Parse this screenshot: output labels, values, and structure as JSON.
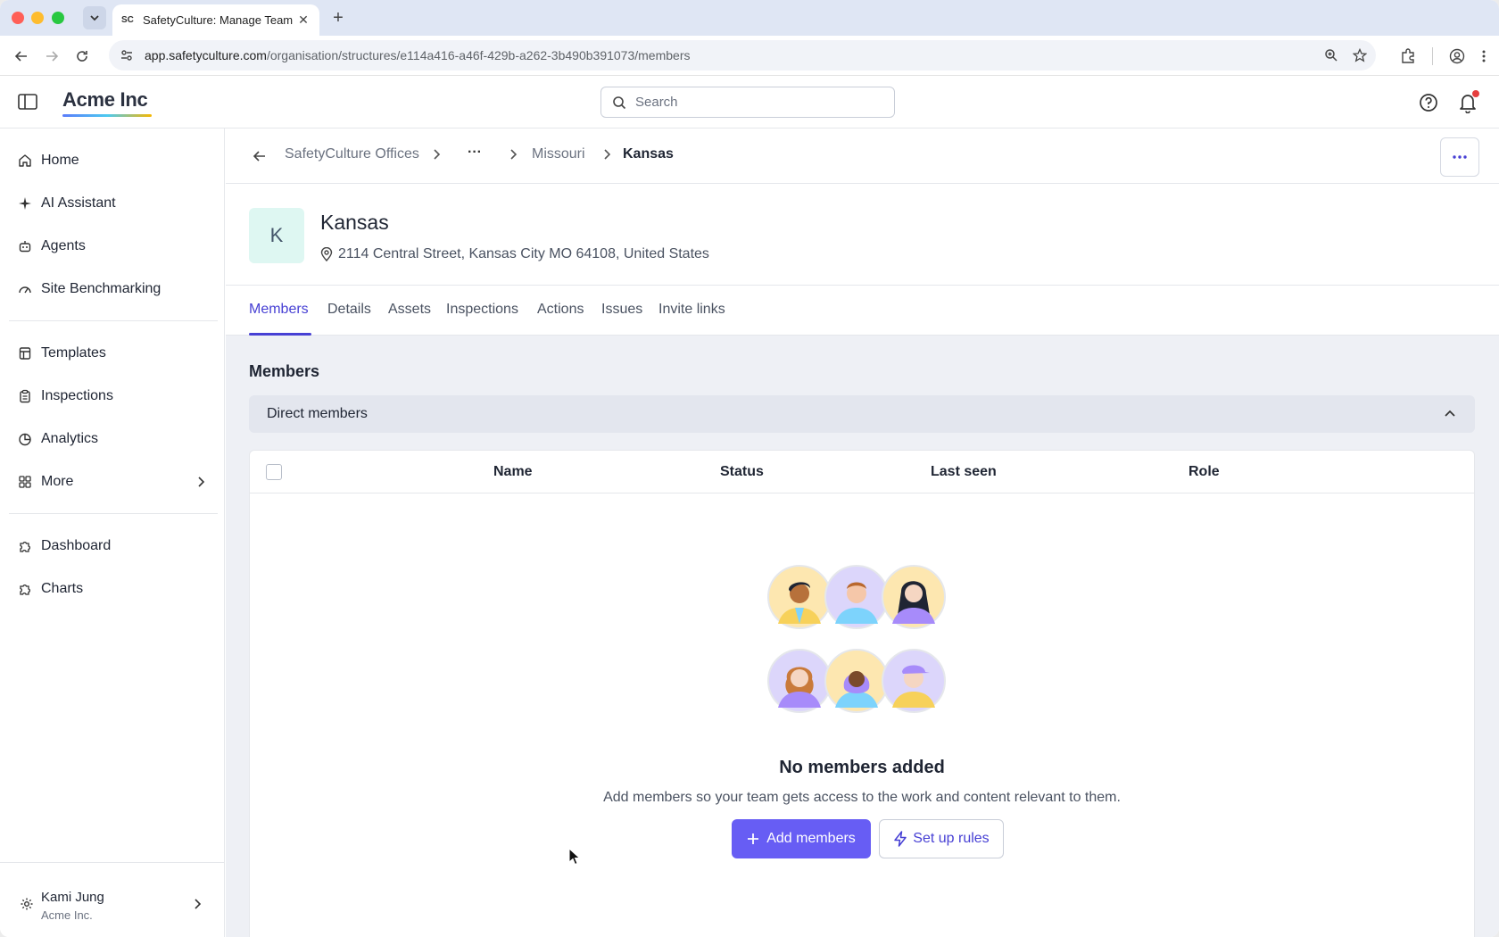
{
  "browser": {
    "tab_title": "SafetyCulture: Manage Team",
    "favicon": "SC",
    "url_domain": "app.safetyculture.com",
    "url_path": "/organisation/structures/e114a416-a46f-429b-a262-3b490b391073/members"
  },
  "header": {
    "brand": "Acme Inc",
    "search_placeholder": "Search"
  },
  "sidebar": {
    "items": [
      {
        "label": "Home",
        "icon": "home-icon"
      },
      {
        "label": "AI Assistant",
        "icon": "sparkle-icon"
      },
      {
        "label": "Agents",
        "icon": "robot-icon"
      },
      {
        "label": "Site Benchmarking",
        "icon": "gauge-icon"
      },
      {
        "label": "Templates",
        "icon": "template-icon"
      },
      {
        "label": "Inspections",
        "icon": "clipboard-icon"
      },
      {
        "label": "Analytics",
        "icon": "pie-chart-icon"
      },
      {
        "label": "More",
        "icon": "grid-icon"
      },
      {
        "label": "Dashboard",
        "icon": "puzzle-icon"
      },
      {
        "label": "Charts",
        "icon": "puzzle-icon"
      }
    ],
    "user_name": "Kami Jung",
    "user_org": "Acme Inc."
  },
  "breadcrumb": {
    "root": "SafetyCulture Offices",
    "ellipsis": "···",
    "parent": "Missouri",
    "current": "Kansas"
  },
  "site": {
    "initial": "K",
    "name": "Kansas",
    "address": "2114 Central Street, Kansas City MO 64108, United States"
  },
  "tabs": [
    "Members",
    "Details",
    "Assets",
    "Inspections",
    "Actions",
    "Issues",
    "Invite links"
  ],
  "members": {
    "section_title": "Members",
    "accordion_label": "Direct members",
    "columns": [
      "Name",
      "Status",
      "Last seen",
      "Role"
    ],
    "empty_title": "No members added",
    "empty_subtitle": "Add members so your team gets access to the work and content relevant to them.",
    "add_button": "Add members",
    "rules_button": "Set up rules"
  },
  "colors": {
    "accent": "#675df4",
    "accent_text": "#4740d4"
  }
}
